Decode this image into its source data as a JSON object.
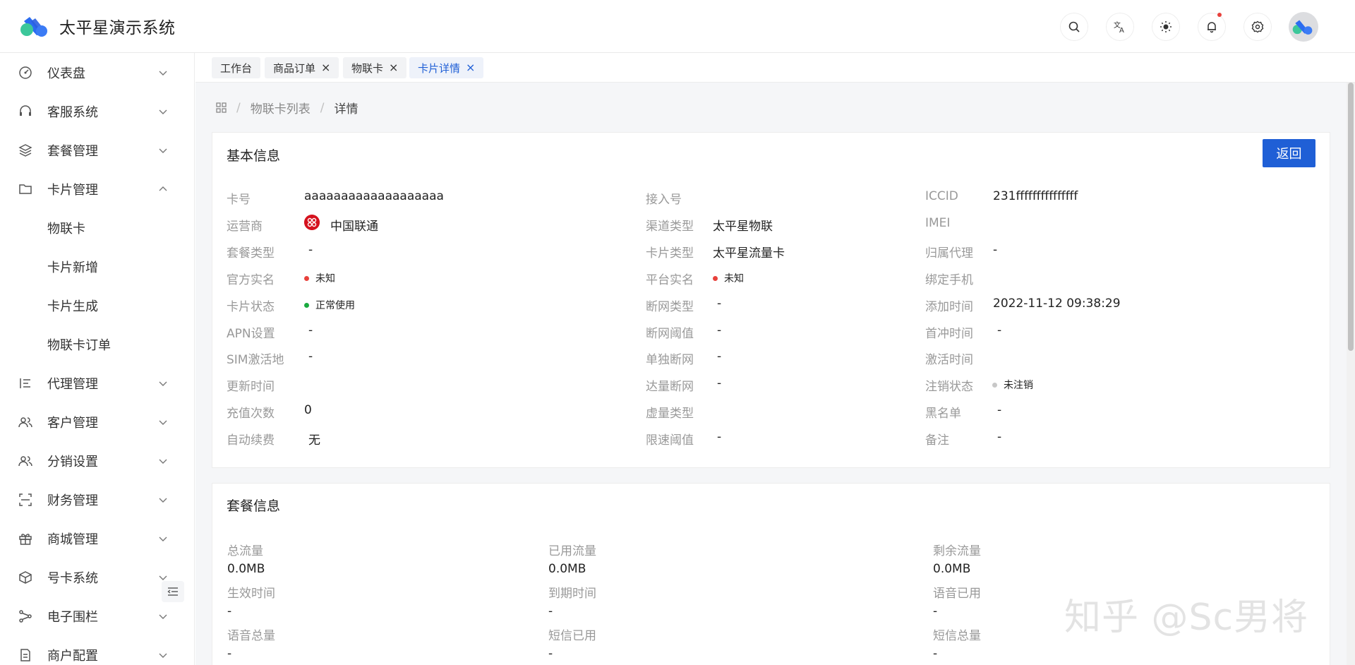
{
  "app": {
    "title": "太平星演示系统"
  },
  "header": {
    "icons": [
      "search-icon",
      "translate-icon",
      "theme-icon",
      "bell-icon",
      "gear-icon"
    ]
  },
  "sidebar": {
    "items": [
      {
        "label": "仪表盘",
        "icon": "dashboard-icon",
        "expanded": false
      },
      {
        "label": "客服系统",
        "icon": "headset-icon",
        "expanded": false
      },
      {
        "label": "套餐管理",
        "icon": "layers-icon",
        "expanded": false
      },
      {
        "label": "卡片管理",
        "icon": "folder-icon",
        "expanded": true,
        "children": [
          {
            "label": "物联卡"
          },
          {
            "label": "卡片新增"
          },
          {
            "label": "卡片生成"
          },
          {
            "label": "物联卡订单"
          }
        ]
      },
      {
        "label": "代理管理",
        "icon": "list-icon",
        "expanded": false
      },
      {
        "label": "客户管理",
        "icon": "users-icon",
        "expanded": false
      },
      {
        "label": "分销设置",
        "icon": "users-icon",
        "expanded": false
      },
      {
        "label": "财务管理",
        "icon": "scan-icon",
        "expanded": false
      },
      {
        "label": "商城管理",
        "icon": "gift-icon",
        "expanded": false
      },
      {
        "label": "号卡系统",
        "icon": "cube-icon",
        "expanded": false
      },
      {
        "label": "电子围栏",
        "icon": "share-icon",
        "expanded": false
      },
      {
        "label": "商户配置",
        "icon": "document-icon",
        "expanded": false
      }
    ]
  },
  "tabs": [
    {
      "label": "工作台",
      "closable": false,
      "active": false
    },
    {
      "label": "商品订单",
      "closable": true,
      "active": false
    },
    {
      "label": "物联卡",
      "closable": true,
      "active": false
    },
    {
      "label": "卡片详情",
      "closable": true,
      "active": true
    }
  ],
  "breadcrumb": {
    "items": [
      "物联卡列表",
      "详情"
    ],
    "sep": "/"
  },
  "basic": {
    "title": "基本信息",
    "back_label": "返回",
    "col1": [
      {
        "label": "卡号",
        "value": "aaaaaaaaaaaaaaaaaaa"
      },
      {
        "label": "运营商",
        "value": "中国联通"
      },
      {
        "label": "套餐类型",
        "value": "-"
      },
      {
        "label": "官方实名",
        "value": "未知",
        "status": "red"
      },
      {
        "label": "卡片状态",
        "value": "正常使用",
        "status": "green"
      },
      {
        "label": "APN设置",
        "value": "-"
      },
      {
        "label": "SIM激活地",
        "value": "-"
      },
      {
        "label": "更新时间",
        "value": ""
      },
      {
        "label": "充值次数",
        "value": "0"
      },
      {
        "label": "自动续费",
        "value": "无"
      }
    ],
    "col2": [
      {
        "label": "接入号",
        "value": ""
      },
      {
        "label": "渠道类型",
        "value": "太平星物联"
      },
      {
        "label": "卡片类型",
        "value": "太平星流量卡"
      },
      {
        "label": "平台实名",
        "value": "未知",
        "status": "red"
      },
      {
        "label": "断网类型",
        "value": "-"
      },
      {
        "label": "断网阈值",
        "value": "-"
      },
      {
        "label": "单独断网",
        "value": "-"
      },
      {
        "label": "达量断网",
        "value": "-"
      },
      {
        "label": "虚量类型",
        "value": ""
      },
      {
        "label": "限速阈值",
        "value": "-"
      }
    ],
    "col3": [
      {
        "label": "ICCID",
        "value": "231fffffffffffffff"
      },
      {
        "label": "IMEI",
        "value": ""
      },
      {
        "label": "归属代理",
        "value": "-"
      },
      {
        "label": "绑定手机",
        "value": ""
      },
      {
        "label": "添加时间",
        "value": "2022-11-12 09:38:29"
      },
      {
        "label": "首冲时间",
        "value": "-"
      },
      {
        "label": "激活时间",
        "value": ""
      },
      {
        "label": "注销状态",
        "value": "未注销",
        "status": "gray"
      },
      {
        "label": "黑名单",
        "value": "-"
      },
      {
        "label": "备注",
        "value": "-"
      }
    ]
  },
  "package": {
    "title": "套餐信息",
    "fields": [
      {
        "label": "总流量",
        "value": "0.0MB"
      },
      {
        "label": "已用流量",
        "value": "0.0MB"
      },
      {
        "label": "剩余流量",
        "value": "0.0MB"
      },
      {
        "label": "生效时间",
        "value": "-"
      },
      {
        "label": "到期时间",
        "value": "-"
      },
      {
        "label": "语音已用",
        "value": "-"
      },
      {
        "label": "语音总量",
        "value": "-"
      },
      {
        "label": "短信已用",
        "value": "-"
      },
      {
        "label": "短信总量",
        "value": "-"
      }
    ]
  },
  "colors": {
    "primary": "#1f5fd6",
    "status_red": "#e8413c",
    "status_green": "#1aaa3f",
    "status_gray": "#c8c8c8"
  },
  "watermark": "知乎 @Sc男将"
}
